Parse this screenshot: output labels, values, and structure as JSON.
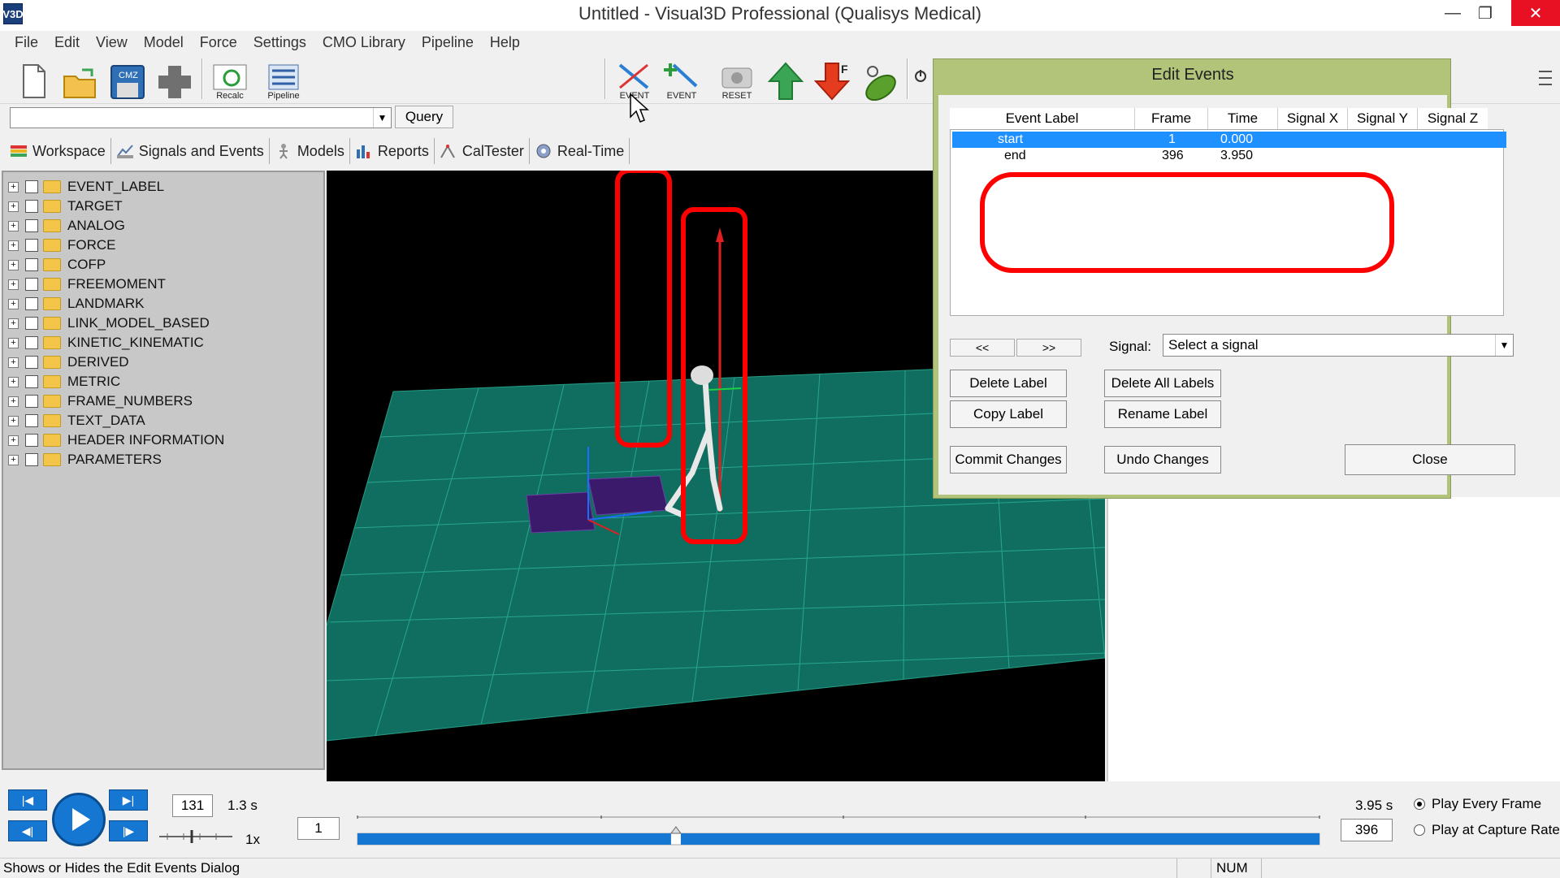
{
  "window": {
    "app_icon": "V3D",
    "title": "Untitled - Visual3D Professional (Qualisys Medical)",
    "minimize": "—",
    "maximize": "❐",
    "close": "✕"
  },
  "menu": [
    "File",
    "Edit",
    "View",
    "Model",
    "Force",
    "Settings",
    "CMO Library",
    "Pipeline",
    "Help"
  ],
  "toolbar": {
    "icons": [
      "new-file-icon",
      "open-folder-icon",
      "save-cmz-icon",
      "plugin-icon",
      "recalc-icon",
      "pipeline-icon",
      "event-icon",
      "add-event-icon",
      "reset-icon",
      "up-arrow-icon",
      "force-down-icon",
      "green-tool-icon",
      "power-icon"
    ],
    "recalc_label": "Recalc",
    "pipeline_label": "Pipeline",
    "event_label": "EVENT",
    "add_event_label": "EVENT",
    "reset_label": "RESET",
    "save_label": "CMZ",
    "force_label": "F"
  },
  "query": {
    "value": "",
    "button_label": "Query"
  },
  "tabs": [
    {
      "label": "Workspace",
      "icon": "workspace-icon"
    },
    {
      "label": "Signals and Events",
      "icon": "signals-icon"
    },
    {
      "label": "Models",
      "icon": "models-icon"
    },
    {
      "label": "Reports",
      "icon": "reports-icon"
    },
    {
      "label": "CalTester",
      "icon": "caltester-icon"
    },
    {
      "label": "Real-Time",
      "icon": "realtime-icon"
    }
  ],
  "tree": [
    "EVENT_LABEL",
    "TARGET",
    "ANALOG",
    "FORCE",
    "COFP",
    "FREEMOMENT",
    "LANDMARK",
    "LINK_MODEL_BASED",
    "KINETIC_KINEMATIC",
    "DERIVED",
    "METRIC",
    "FRAME_NUMBERS",
    "TEXT_DATA",
    "HEADER INFORMATION",
    "PARAMETERS"
  ],
  "tree_expander": "+",
  "edit_events": {
    "title": "Edit Events",
    "columns": [
      "Event Label",
      "Frame",
      "Time",
      "Signal X",
      "Signal Y",
      "Signal Z"
    ],
    "rows": [
      {
        "label": "start",
        "frame": "1",
        "time": "0.000",
        "selected": true
      },
      {
        "label": "end",
        "frame": "396",
        "time": "3.950",
        "selected": false
      }
    ],
    "prev_label": "<<",
    "next_label": ">>",
    "signal_label": "Signal:",
    "signal_value": "Select a signal",
    "delete_label": "Delete Label",
    "delete_all": "Delete All Labels",
    "copy_label": "Copy Label",
    "rename_label": "Rename Label",
    "commit": "Commit Changes",
    "undo": "Undo Changes",
    "close": "Close"
  },
  "playback": {
    "current_frame": "131",
    "current_time": "1.3 s",
    "speed": "1x",
    "start_frame": "1",
    "end_time": "3.95 s",
    "end_frame": "396",
    "play_every_frame": "Play Every Frame",
    "play_capture_rate": "Play at Capture Rate",
    "progress_fraction": 0.331
  },
  "status": {
    "message": "Shows or Hides the Edit Events Dialog",
    "num": "NUM"
  },
  "colors": {
    "highlight_red": "#ff0000",
    "selection_blue": "#1e90ff",
    "dialog_frame": "#b2c37a",
    "grid_floor": "#0f6e5f"
  }
}
